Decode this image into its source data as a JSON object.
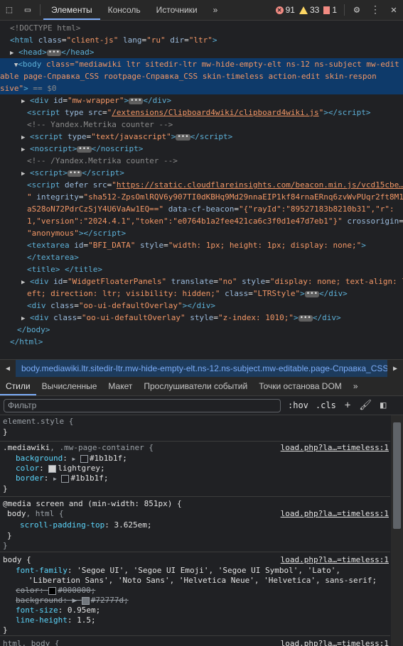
{
  "toolbar": {
    "tabs": [
      "Элементы",
      "Консоль",
      "Источники"
    ],
    "errors": "91",
    "warnings": "33",
    "issues": "1",
    "more": "»",
    "menu": "⋮",
    "close": "✕"
  },
  "dom": {
    "doctype": "<!DOCTYPE html>",
    "html_open_tag": "html",
    "html_attrs": [
      [
        "class",
        "client-js"
      ],
      [
        "lang",
        "ru"
      ],
      [
        "dir",
        "ltr"
      ]
    ],
    "head": "head",
    "body_line1": "class=\"mediawiki ltr sitedir-ltr mw-hide-empty-elt ns-12 ns-subject mw-edit",
    "body_line2": "able page-Справка_CSS rootpage-Справка_CSS skin-timeless action-edit skin-respon",
    "body_line3": "sive\"",
    "body_eq": "== $0",
    "mw_wrapper": "mw-wrapper",
    "clipboard_src": "/extensions/Clipboard4wiki/clipboard4wiki.js",
    "metrika_comment": "<!-- Yandex.Metrika counter -->",
    "js_type": "text/javascript",
    "noscript": "noscript",
    "metrika_end": "<!-- /Yandex.Metrika counter -->",
    "cf_src": "https://static.cloudflareinsights.com/beacon.min.js/vcd15cbe…",
    "integrity_a": "sha512-ZpsOmlRQV6y907TI0dKBHq9Md29nnaEIP1kf84rnaERnq6zvWvPUqr2ft8M1",
    "integrity_b": "aS28oN72PdrCzSjY4U6VaAw1EQ==",
    "beacon_a": "{\"rayId\":\"89527183b8210b31\",\"r\":",
    "beacon_b": "1,\"version\":\"2024.4.1\",\"token\":\"e0764b1a2fee421ca6c3f0d1e47d7eb1\"}",
    "crossorigin": "anonymous",
    "textarea_id": "BFI_DATA",
    "textarea_style": "width: 1px; height: 1px; display: none;",
    "panels_id": "WidgetFloaterPanels",
    "panels_translate": "no",
    "panels_style_a": "display: none; text-align: l",
    "panels_style_b": "eft; direction: ltr; visibility: hidden;",
    "panels_class": "LTRStyle",
    "overlay_class": "oo-ui-defaultOverlay",
    "overlay_style": "z-index: 1010;"
  },
  "breadcrumb": "body.mediawiki.ltr.sitedir-ltr.mw-hide-empty-elt.ns-12.ns-subject.mw-editable.page-Справка_CSS",
  "subtabs": [
    "Стили",
    "Вычисленные",
    "Макет",
    "Прослушиватели событий",
    "Точки останова DOM"
  ],
  "filter": {
    "placeholder": "Фильтр",
    "hov": ":hov",
    "cls": ".cls"
  },
  "styles": {
    "element_style": "element.style {",
    "r1_selector": ".mediawiki",
    "r1_selector2": ", .mw-page-container {",
    "r1_src": "load.php?la…=timeless:1",
    "r1_props": [
      [
        "background",
        "#1b1b1f"
      ],
      [
        "color",
        "lightgrey"
      ],
      [
        "border",
        "#1b1b1f"
      ]
    ],
    "media": "@media screen and (min-width: 851px) {",
    "r2_selector": "body",
    "r2_selector2": ", html {",
    "r2_src": "load.php?la…=timeless:1",
    "r2_prop": "scroll-padding-top",
    "r2_val": "3.625em;",
    "r3_selector": "body {",
    "r3_src": "load.php?la…=timeless:1",
    "ff_a": "'Segoe UI', 'Segoe UI Emoji', 'Segoe UI Symbol', 'Lato',",
    "ff_b": "'Liberation Sans', 'Noto Sans', 'Helvetica Neue', 'Helvetica', sans-serif;",
    "color_val": "#000000;",
    "bg_val": "#72777d;",
    "fs_val": "0.95em;",
    "lh_val": "1.5;",
    "r4_selector": "html, body {",
    "r4_src": "load.php?la…=timeless:1"
  }
}
